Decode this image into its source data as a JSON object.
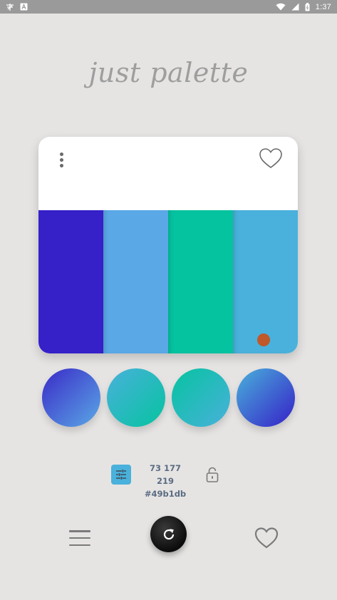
{
  "statusbar": {
    "time": "1:37",
    "left_icons": [
      "app-notification-icon",
      "text-notification-icon"
    ],
    "right_icons": [
      "wifi-icon",
      "signal-icon",
      "battery-icon"
    ]
  },
  "app": {
    "title": "just palette"
  },
  "palette": {
    "swatches": [
      {
        "color": "#3620c8"
      },
      {
        "color": "#5aa8e6"
      },
      {
        "color": "#06c3a0"
      },
      {
        "color": "#49b1db",
        "selected": true
      }
    ],
    "selected_marker_color": "#c0582a"
  },
  "gradients": [
    {
      "from": "#3a2ac7",
      "to": "#5aa8e6"
    },
    {
      "from": "#49b1db",
      "to": "#06c3a0"
    },
    {
      "from": "#06c3a0",
      "to": "#49b1db"
    },
    {
      "from": "#49b1db",
      "to": "#3620c8"
    }
  ],
  "selected_color": {
    "rgb": "73 177 219",
    "hex": "#49b1db"
  },
  "colors": {
    "background": "#e6e4e3",
    "card": "#ffffff",
    "accent": "#49b1db",
    "refresh_button": "#111111"
  }
}
